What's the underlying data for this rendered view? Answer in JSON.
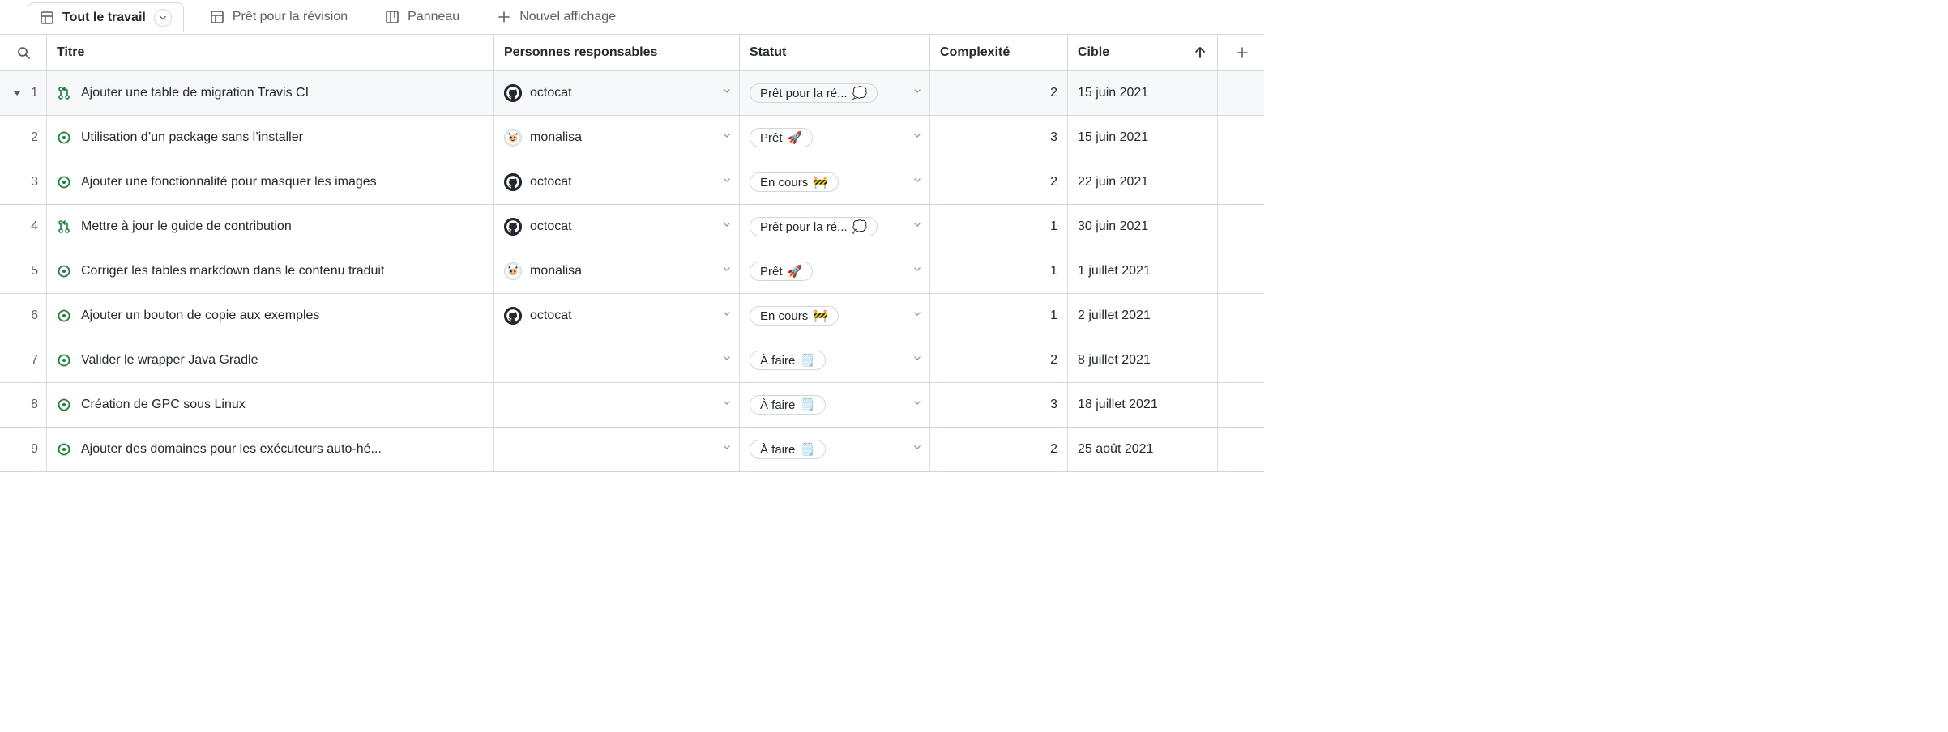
{
  "tabs": {
    "active": {
      "label": "Tout le travail"
    },
    "review": {
      "label": "Prêt pour la révision"
    },
    "board": {
      "label": "Panneau"
    },
    "new": {
      "label": "Nouvel affichage"
    }
  },
  "columns": {
    "title": "Titre",
    "assignee": "Personnes responsables",
    "status": "Statut",
    "complexity": "Complexité",
    "target": "Cible"
  },
  "assignees": {
    "octocat": {
      "name": "octocat",
      "avatar": "github"
    },
    "monalisa": {
      "name": "monalisa",
      "avatar": "mona"
    }
  },
  "statuses": {
    "ready_review": {
      "label": "Prêt pour la ré...",
      "emoji": "💭"
    },
    "ready": {
      "label": "Prêt",
      "emoji": "🚀"
    },
    "in_progress": {
      "label": "En cours",
      "emoji": "🚧"
    },
    "todo": {
      "label": "À faire",
      "emoji": "🗒️"
    }
  },
  "rows": [
    {
      "num": "1",
      "type": "pr",
      "title": "Ajouter une table de migration Travis CI",
      "assignee": "octocat",
      "status": "ready_review",
      "complexity": "2",
      "target": "15 juin 2021",
      "selected": true
    },
    {
      "num": "2",
      "type": "issue",
      "title": "Utilisation d’un package sans l’installer",
      "assignee": "monalisa",
      "status": "ready",
      "complexity": "3",
      "target": "15 juin 2021",
      "selected": false
    },
    {
      "num": "3",
      "type": "issue",
      "title": "Ajouter une fonctionnalité pour masquer les images",
      "assignee": "octocat",
      "status": "in_progress",
      "complexity": "2",
      "target": "22 juin 2021",
      "selected": false
    },
    {
      "num": "4",
      "type": "pr",
      "title": "Mettre à jour le guide de contribution",
      "assignee": "octocat",
      "status": "ready_review",
      "complexity": "1",
      "target": "30 juin 2021",
      "selected": false
    },
    {
      "num": "5",
      "type": "issue",
      "title": "Corriger les tables markdown dans le contenu traduit",
      "assignee": "monalisa",
      "status": "ready",
      "complexity": "1",
      "target": "1 juillet 2021",
      "selected": false
    },
    {
      "num": "6",
      "type": "issue",
      "title": "Ajouter un bouton de copie aux exemples",
      "assignee": "octocat",
      "status": "in_progress",
      "complexity": "1",
      "target": "2 juillet 2021",
      "selected": false
    },
    {
      "num": "7",
      "type": "issue",
      "title": "Valider le wrapper Java Gradle",
      "assignee": null,
      "status": "todo",
      "complexity": "2",
      "target": "8 juillet 2021",
      "selected": false
    },
    {
      "num": "8",
      "type": "issue",
      "title": "Création de GPC sous Linux",
      "assignee": null,
      "status": "todo",
      "complexity": "3",
      "target": "18 juillet 2021",
      "selected": false
    },
    {
      "num": "9",
      "type": "issue",
      "title": "Ajouter des domaines pour les exécuteurs auto-hé...",
      "assignee": null,
      "status": "todo",
      "complexity": "2",
      "target": "25 août 2021",
      "selected": false
    }
  ]
}
